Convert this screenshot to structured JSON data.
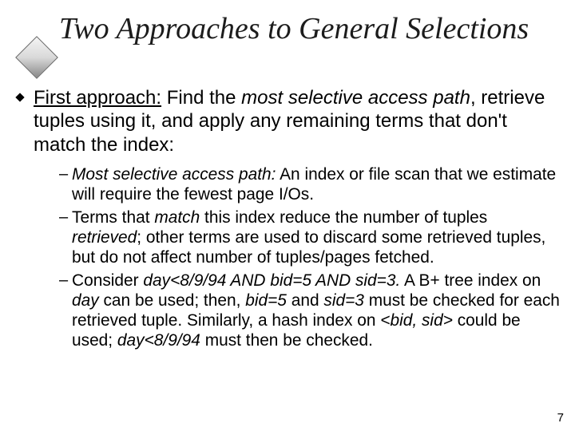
{
  "slide": {
    "title": "Two Approaches to General Selections",
    "page_number": "7",
    "lvl1": {
      "lead_underlined": "First approach:",
      "seg1": " Find the ",
      "seg2_italic": "most selective access path",
      "seg3": ", retrieve tuples using it, and apply any remaining terms that don't match the index:"
    },
    "sub": [
      {
        "a_italic": "Most selective access path:",
        "b": " An index or file scan that we estimate will require the fewest page I/Os."
      },
      {
        "a": "Terms that ",
        "b_italic": "match",
        "c": " this index reduce the number of tuples ",
        "d_italic": "retrieved",
        "e": "; other terms are used to discard some retrieved tuples, but do not affect number of tuples/pages fetched."
      },
      {
        "a": "Consider ",
        "b_italic": "day<8/9/94 AND bid=5 AND sid=3.",
        "c": " A B+ tree index on  ",
        "d_italic": "day",
        "e": " can be used; then, ",
        "f_italic": "bid=5",
        "g": " and ",
        "h_italic": "sid=3",
        "i": " must be checked for each retrieved tuple.  Similarly, a hash index on ",
        "j_italic": "<bid, sid>",
        "k": " could be used; ",
        "l_italic": "day<8/9/94",
        "m": " must then be checked."
      }
    ]
  }
}
